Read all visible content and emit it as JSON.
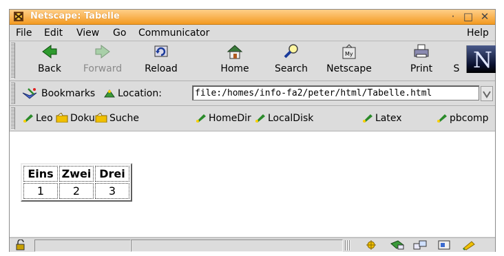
{
  "window": {
    "title": "Netscape: Tabelle",
    "controls": [
      "·",
      "□",
      "✕"
    ]
  },
  "menu": {
    "items": [
      "File",
      "Edit",
      "View",
      "Go",
      "Communicator"
    ],
    "help": "Help"
  },
  "toolbar": {
    "buttons": [
      {
        "label": "Back",
        "icon": "back-arrow-icon",
        "disabled": false
      },
      {
        "label": "Forward",
        "icon": "forward-arrow-icon",
        "disabled": true
      },
      {
        "label": "Reload",
        "icon": "reload-icon",
        "disabled": false
      },
      {
        "label": "Home",
        "icon": "home-icon",
        "disabled": false
      },
      {
        "label": "Search",
        "icon": "search-icon",
        "disabled": false
      },
      {
        "label": "Netscape",
        "icon": "netscape-icon",
        "disabled": false
      },
      {
        "label": "Print",
        "icon": "print-icon",
        "disabled": false
      },
      {
        "label": "S",
        "icon": "security-icon",
        "disabled": false
      }
    ],
    "logo": "N"
  },
  "location": {
    "bookmarks_label": "Bookmarks",
    "location_label": "Location:",
    "url": "file:/homes/info-fa2/peter/html/Tabelle.html"
  },
  "personal": {
    "items": [
      "Leo",
      "Doku",
      "Suche",
      "HomeDir",
      "LocalDisk",
      "Latex",
      "pbcomp"
    ]
  },
  "content": {
    "table": {
      "headers": [
        "Eins",
        "Zwei",
        "Drei"
      ],
      "rows": [
        [
          "1",
          "2",
          "3"
        ]
      ]
    }
  },
  "colors": {
    "titlebar": "#f39a22",
    "chrome": "#dcdcdc",
    "link_icon": "#2a8a2a",
    "accent": "#ffd000"
  }
}
